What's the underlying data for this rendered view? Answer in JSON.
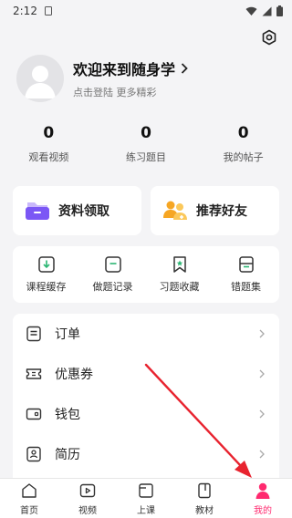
{
  "status_bar": {
    "time": "2:12"
  },
  "profile": {
    "title": "欢迎来到随身学",
    "subtitle": "点击登陆 更多精彩"
  },
  "stats": [
    {
      "value": "0",
      "label": "观看视频"
    },
    {
      "value": "0",
      "label": "练习题目"
    },
    {
      "value": "0",
      "label": "我的帖子"
    }
  ],
  "promos": [
    {
      "label": "资料领取",
      "icon": "folder-icon"
    },
    {
      "label": "推荐好友",
      "icon": "friends-icon"
    }
  ],
  "tools": [
    {
      "label": "课程缓存",
      "icon": "download-icon"
    },
    {
      "label": "做题记录",
      "icon": "record-icon"
    },
    {
      "label": "习题收藏",
      "icon": "bookmark-icon"
    },
    {
      "label": "错题集",
      "icon": "wrong-set-icon"
    }
  ],
  "menu": [
    {
      "label": "订单",
      "icon": "order-icon"
    },
    {
      "label": "优惠券",
      "icon": "coupon-icon"
    },
    {
      "label": "钱包",
      "icon": "wallet-icon"
    },
    {
      "label": "简历",
      "icon": "resume-icon"
    }
  ],
  "tabs": [
    {
      "label": "首页",
      "icon": "home-icon"
    },
    {
      "label": "视频",
      "icon": "video-icon"
    },
    {
      "label": "上课",
      "icon": "class-icon"
    },
    {
      "label": "教材",
      "icon": "textbook-icon"
    },
    {
      "label": "我的",
      "icon": "profile-icon",
      "active": true
    }
  ],
  "colors": {
    "accent": "#ff2a6f",
    "arrow": "#e8232f",
    "folder": "#7b57f5",
    "friends": "#f6a623"
  }
}
